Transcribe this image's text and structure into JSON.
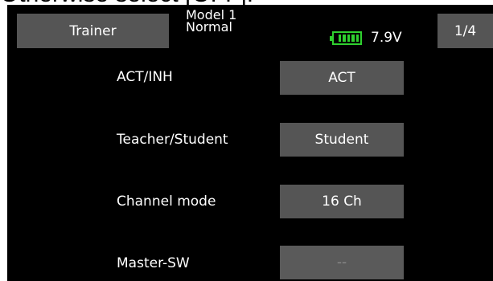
{
  "clipped_text": "Otherwise select [OFF].",
  "header": {
    "tab_label": "Trainer",
    "model_name": "Model 1",
    "condition": "Normal",
    "voltage": "7.9V",
    "page": "1/4",
    "battery_color": "#2fd12f"
  },
  "rows": [
    {
      "label": "ACT/INH",
      "value": "ACT"
    },
    {
      "label": "Teacher/Student",
      "value": "Student"
    },
    {
      "label": "Channel mode",
      "value": "16 Ch"
    },
    {
      "label": "Master-SW",
      "value": "--"
    }
  ]
}
